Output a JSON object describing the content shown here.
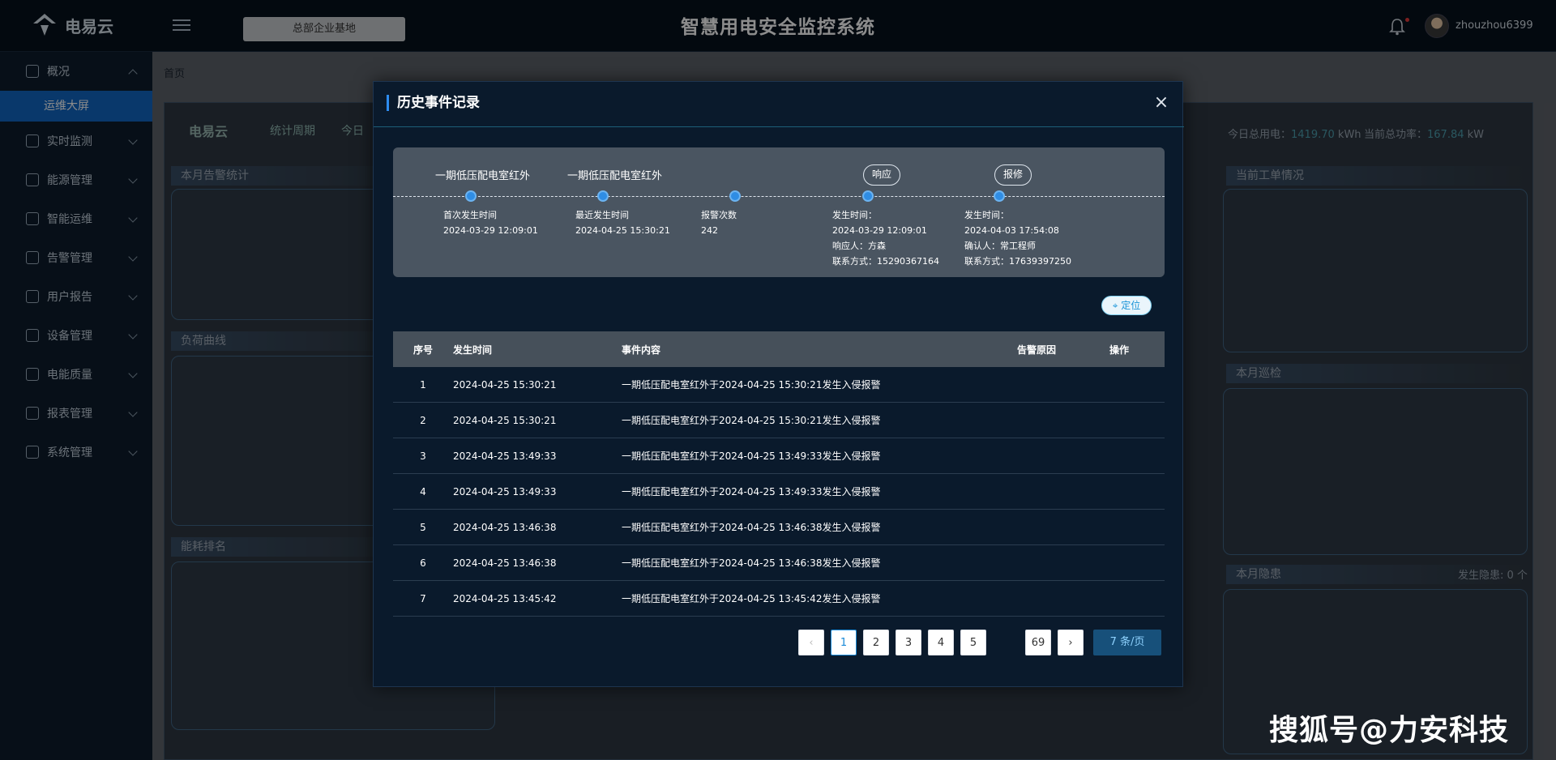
{
  "brand": {
    "name": "电易云"
  },
  "topbar": {
    "site": "总部企业基地",
    "title": "智慧用电安全监控系统",
    "user": "zhouzhou6399"
  },
  "sidebar": {
    "items": [
      {
        "label": "概况",
        "expanded": true
      },
      {
        "label": "实时监测"
      },
      {
        "label": "能源管理"
      },
      {
        "label": "智能运维"
      },
      {
        "label": "告警管理"
      },
      {
        "label": "用户报告"
      },
      {
        "label": "设备管理"
      },
      {
        "label": "电能质量"
      },
      {
        "label": "报表管理"
      },
      {
        "label": "系统管理"
      }
    ],
    "active_sub": "运维大屏"
  },
  "main": {
    "breadcrumb": "首页",
    "dashboard": {
      "logo": "电易云",
      "tab_period": "统计周期",
      "tab_today": "今日",
      "today_energy_label": "今日总用电：",
      "today_energy_value": "1419.70",
      "today_energy_unit": "kWh",
      "power_label": "当前总功率：",
      "power_value": "167.84",
      "power_unit": "kW",
      "panels": {
        "alarm_stats": "本月告警统计",
        "load_curve": "负荷曲线",
        "energy_rank": "能耗排名",
        "work_orders": "当前工单情况",
        "inspection": "本月巡检",
        "hazards": "本月隐患",
        "hazard_count": "发生隐患: 0 个"
      }
    }
  },
  "modal": {
    "title": "历史事件记录",
    "timeline": {
      "first": {
        "title": "一期低压配电室红外",
        "label": "首次发生时间",
        "value": "2024-03-29 12:09:01"
      },
      "latest": {
        "title": "一期低压配电室红外",
        "label": "最近发生时间",
        "value": "2024-04-25 15:30:21"
      },
      "count": {
        "label": "报警次数",
        "value": "242"
      },
      "response": {
        "badge": "响应",
        "time_label": "发生时间：",
        "time_value": "2024-03-29 12:09:01",
        "person": "响应人：方森",
        "contact": "联系方式：15290367164"
      },
      "repair": {
        "badge": "报修",
        "time_label": "发生时间：",
        "time_value": "2024-04-03 17:54:08",
        "person": "确认人：常工程师",
        "contact": "联系方式：17639397250"
      }
    },
    "locate_label": "定位",
    "table": {
      "headers": [
        "序号",
        "发生时间",
        "事件内容",
        "告警原因",
        "操作"
      ],
      "rows": [
        {
          "no": "1",
          "time": "2024-04-25 15:30:21",
          "content": "一期低压配电室红外于2024-04-25 15:30:21发生入侵报警"
        },
        {
          "no": "2",
          "time": "2024-04-25 15:30:21",
          "content": "一期低压配电室红外于2024-04-25 15:30:21发生入侵报警"
        },
        {
          "no": "3",
          "time": "2024-04-25 13:49:33",
          "content": "一期低压配电室红外于2024-04-25 13:49:33发生入侵报警"
        },
        {
          "no": "4",
          "time": "2024-04-25 13:49:33",
          "content": "一期低压配电室红外于2024-04-25 13:49:33发生入侵报警"
        },
        {
          "no": "5",
          "time": "2024-04-25 13:46:38",
          "content": "一期低压配电室红外于2024-04-25 13:46:38发生入侵报警"
        },
        {
          "no": "6",
          "time": "2024-04-25 13:46:38",
          "content": "一期低压配电室红外于2024-04-25 13:46:38发生入侵报警"
        },
        {
          "no": "7",
          "time": "2024-04-25 13:45:42",
          "content": "一期低压配电室红外于2024-04-25 13:45:42发生入侵报警"
        }
      ]
    },
    "pagination": {
      "pages": [
        "1",
        "2",
        "3",
        "4",
        "5"
      ],
      "last": "69",
      "page_size": "7 条/页"
    }
  },
  "watermark": "搜狐号@力安科技"
}
